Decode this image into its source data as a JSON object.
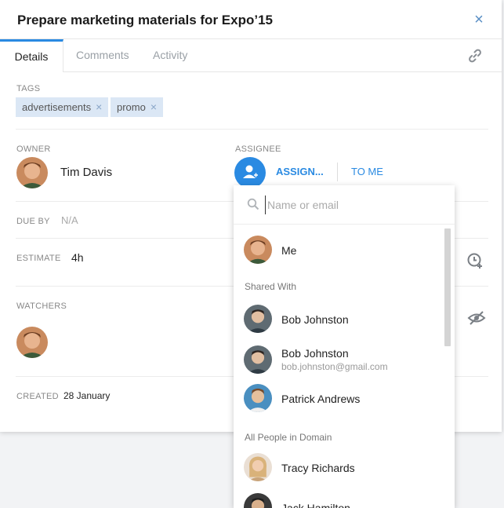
{
  "task": {
    "title": "Prepare marketing materials for Expo’15",
    "close_symbol": "×"
  },
  "tabs": [
    {
      "label": "Details",
      "active": true
    },
    {
      "label": "Comments",
      "active": false
    },
    {
      "label": "Activity",
      "active": false
    }
  ],
  "tags": {
    "label": "TAGS",
    "items": [
      "advertisements",
      "promo"
    ],
    "remove_symbol": "×"
  },
  "owner": {
    "label": "OWNER",
    "name": "Tim Davis"
  },
  "assignee": {
    "label": "ASSIGNEE",
    "assign_label": "ASSIGN...",
    "to_me_label": "TO ME"
  },
  "due_by": {
    "label": "DUE BY",
    "value": "N/A"
  },
  "estimate": {
    "label": "ESTIMATE",
    "value": "4h"
  },
  "watchers": {
    "label": "WATCHERS"
  },
  "created": {
    "label": "CREATED",
    "value": "28 January"
  },
  "dropdown": {
    "placeholder": "Name or email",
    "me": "Me",
    "shared_with_label": "Shared With",
    "shared_with": [
      {
        "name": "Bob Johnston",
        "email": ""
      },
      {
        "name": "Bob Johnston",
        "email": "bob.johnston@gmail.com"
      },
      {
        "name": "Patrick Andrews",
        "email": ""
      }
    ],
    "all_people_label": "All People in Domain",
    "all_people": [
      {
        "name": "Tracy Richards"
      },
      {
        "name": "Jack Hamilton"
      }
    ]
  },
  "colors": {
    "accent": "#2a8ae2",
    "tag_bg": "#dbe7f5"
  }
}
